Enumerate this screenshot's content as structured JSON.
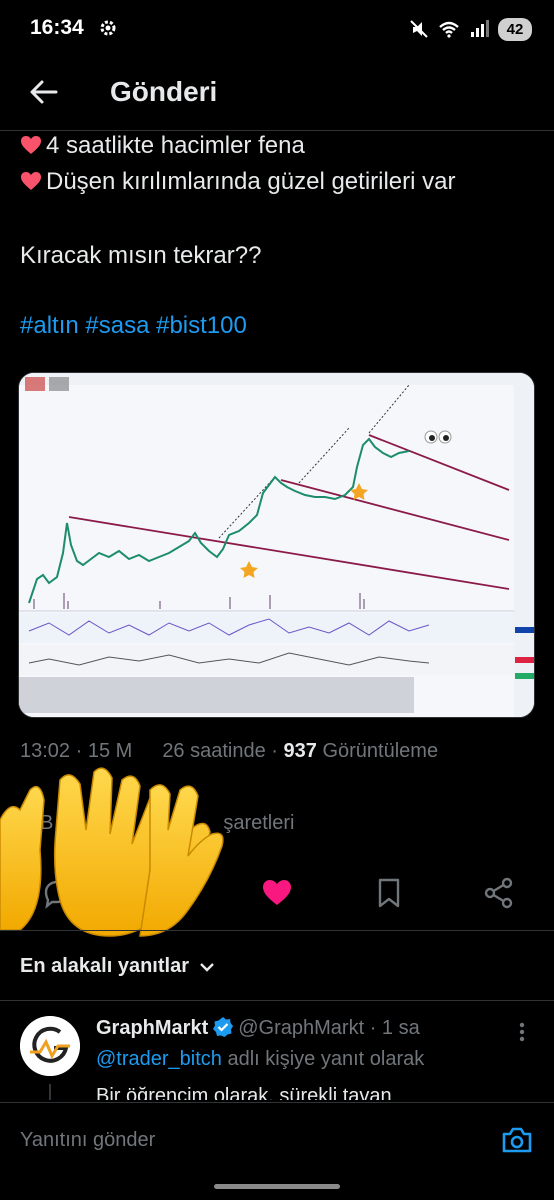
{
  "status_bar": {
    "time": "16:34",
    "battery": "42"
  },
  "header": {
    "title": "Gönderi"
  },
  "tweet": {
    "line1": "4 saatlikte hacimler fena",
    "line2": "Düşen kırılımlarında güzel getirileri var",
    "line3": "Kıracak mısın tekrar??",
    "hashtags": "#altın #sasa #bist100"
  },
  "meta": {
    "time": "13:02",
    "date_prefix": "15 M",
    "date_suffix": "26 saatinde",
    "views": "937",
    "views_label": "Görüntüleme",
    "row2_prefix": "B",
    "row2_suffix": "şaretleri"
  },
  "replies": {
    "sort_label": "En alakalı yanıtlar",
    "first": {
      "name": "GraphMarkt",
      "handle": "@GraphMarkt",
      "age": "· 1 sa",
      "mention": "@trader_bitch",
      "reply_to_suffix": "adlı kişiye yanıt olarak",
      "body": "Bir öğrencim olarak, sürekli tavan"
    }
  },
  "compose": {
    "placeholder": "Yanıtını gönder"
  },
  "colors": {
    "accent": "#1d9bf0",
    "like": "#f91880",
    "text": "#e7e9ea",
    "muted": "#71767b"
  },
  "icons": [
    "back-arrow-icon",
    "reply-icon",
    "retweet-icon",
    "heart-icon",
    "bookmark-icon",
    "share-icon",
    "camera-icon",
    "verified-icon",
    "more-icon",
    "chevron-down-icon"
  ]
}
